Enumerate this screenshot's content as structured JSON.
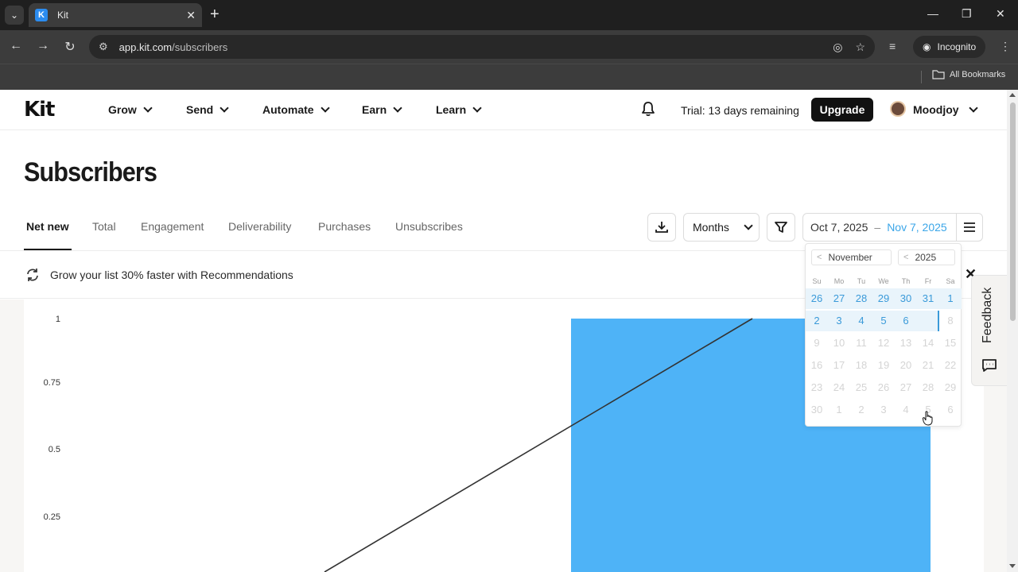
{
  "browser": {
    "tab_title": "Kit",
    "tab_favicon": "K",
    "url_host": "app.kit.com",
    "url_path": "/subscribers",
    "incognito_label": "Incognito",
    "bookmarks_label": "All Bookmarks"
  },
  "nav": {
    "logo": "Kit",
    "items": [
      {
        "label": "Grow"
      },
      {
        "label": "Send"
      },
      {
        "label": "Automate"
      },
      {
        "label": "Earn"
      },
      {
        "label": "Learn"
      }
    ],
    "trial_text": "Trial: 13 days remaining",
    "upgrade_label": "Upgrade",
    "user_name": "Moodjoy"
  },
  "page": {
    "title": "Subscribers",
    "tabs": [
      {
        "label": "Net new",
        "active": true
      },
      {
        "label": "Total"
      },
      {
        "label": "Engagement"
      },
      {
        "label": "Deliverability"
      },
      {
        "label": "Purchases"
      },
      {
        "label": "Unsubscribes"
      }
    ],
    "period_select": "Months",
    "date_from": "Oct 7, 2025",
    "date_sep": "–",
    "date_to": "Nov 7, 2025"
  },
  "recommendation": {
    "text": "Grow your list 30% faster with Recommendations"
  },
  "calendar": {
    "month": "November",
    "year": "2025",
    "weekdays": [
      "Su",
      "Mo",
      "Tu",
      "We",
      "Th",
      "Fr",
      "Sa"
    ],
    "weeks": [
      [
        "26",
        "27",
        "28",
        "29",
        "30",
        "31",
        "1"
      ],
      [
        "2",
        "3",
        "4",
        "5",
        "6",
        "7",
        "8"
      ],
      [
        "9",
        "10",
        "11",
        "12",
        "13",
        "14",
        "15"
      ],
      [
        "16",
        "17",
        "18",
        "19",
        "20",
        "21",
        "22"
      ],
      [
        "23",
        "24",
        "25",
        "26",
        "27",
        "28",
        "29"
      ],
      [
        "30",
        "1",
        "2",
        "3",
        "4",
        "5",
        "6"
      ]
    ]
  },
  "feedback_label": "Feedback",
  "colors": {
    "accent_blue": "#3ba6e8",
    "bar_blue": "#4eb3f7",
    "dark": "#111111"
  },
  "chart_data": {
    "type": "bar",
    "y_ticks": [
      "1",
      "0.75",
      "0.5",
      "0.25"
    ],
    "ylim": [
      0,
      1
    ],
    "bars": [
      {
        "value": 1
      }
    ],
    "trend_line": true
  }
}
